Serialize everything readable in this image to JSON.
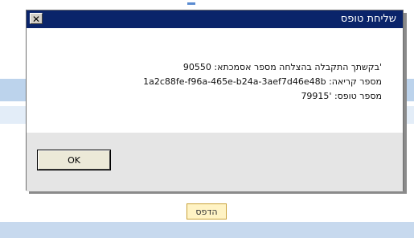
{
  "dialog": {
    "title": "שליחת טופס",
    "close_symbol": "✕",
    "message_lines": [
      "'בקשתך התקבלה בהצלחה מספר אסמכתא: 90550",
      "מספר קריאה: 1a2c88fe-f96a-465e-b24a-3aef7d46e48b",
      "מספר טופס: '79915"
    ],
    "ok_label": "OK"
  },
  "page": {
    "print_label": "הדפס"
  }
}
